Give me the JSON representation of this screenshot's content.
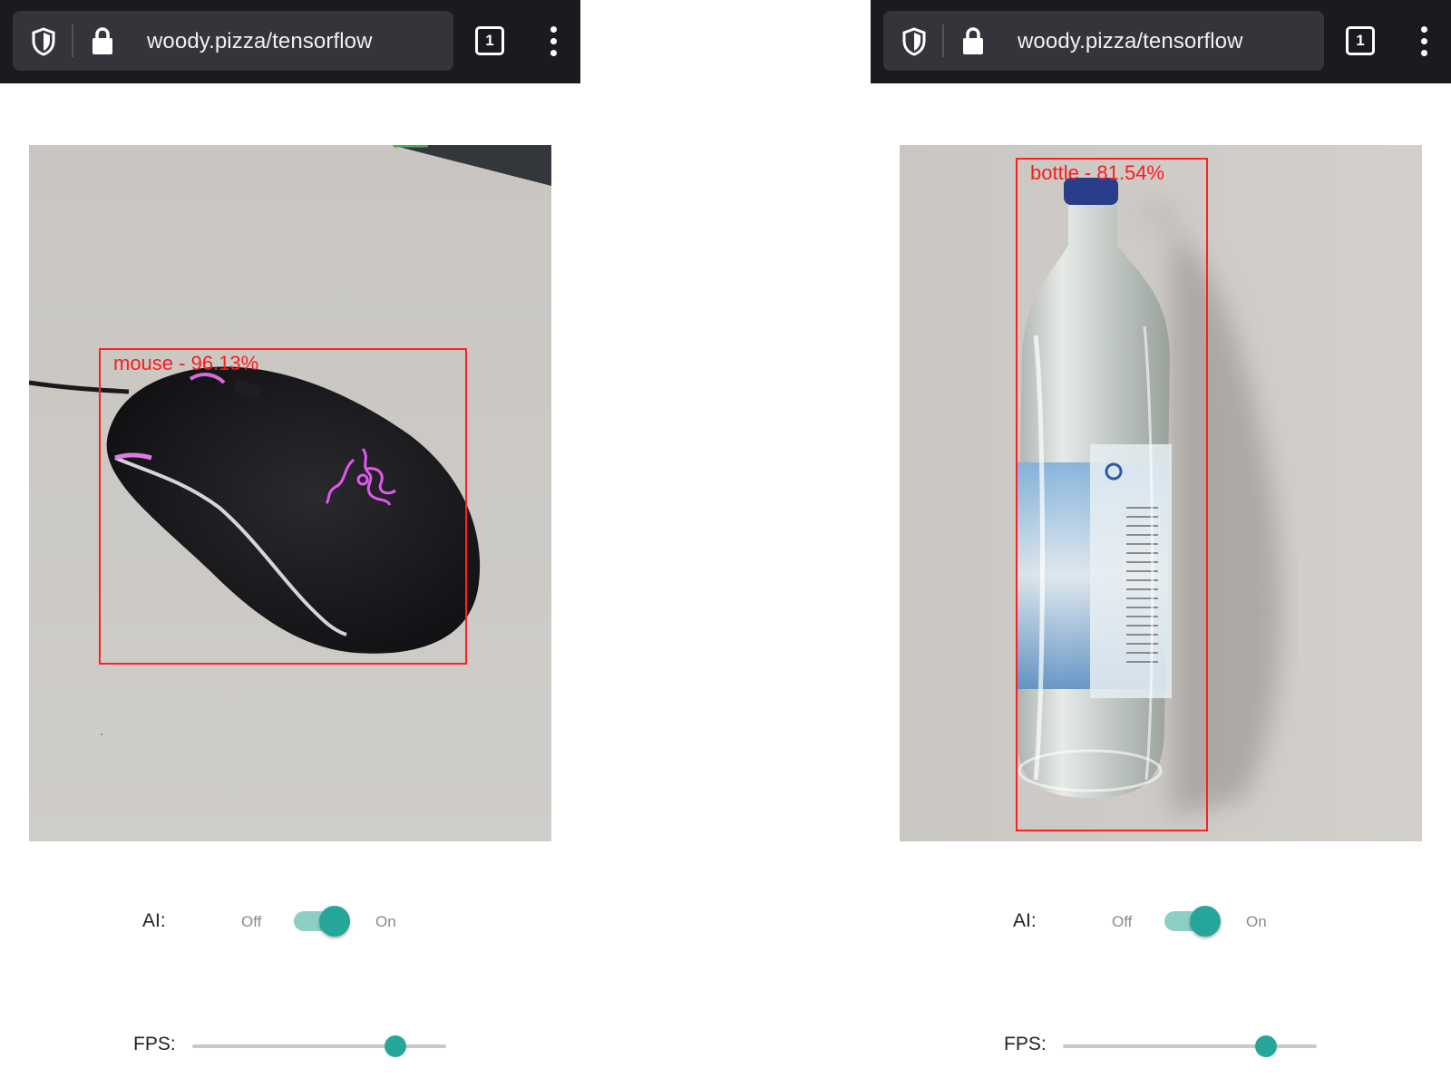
{
  "screens": [
    {
      "browser": {
        "url": "woody.pizza/tensorflow",
        "tab_count": "1",
        "icons": [
          "shield-icon",
          "lock-icon",
          "tabs-icon",
          "more-vert-icon"
        ]
      },
      "detection": {
        "label": "mouse - 96.13%"
      },
      "controls": {
        "ai_label": "AI:",
        "off_label": "Off",
        "on_label": "On",
        "ai_enabled": true,
        "fps_label": "FPS:",
        "fps_value_fraction": 0.8
      }
    },
    {
      "browser": {
        "url": "woody.pizza/tensorflow",
        "tab_count": "1",
        "icons": [
          "shield-icon",
          "lock-icon",
          "tabs-icon",
          "more-vert-icon"
        ]
      },
      "detection": {
        "label": "bottle - 81.54%"
      },
      "controls": {
        "ai_label": "AI:",
        "off_label": "Off",
        "on_label": "On",
        "ai_enabled": true,
        "fps_label": "FPS:",
        "fps_value_fraction": 0.8
      }
    }
  ],
  "colors": {
    "toolbar_bg": "#1b1a1f",
    "urlbar_bg": "#35343a",
    "accent": "#26a69a",
    "accent_light": "#8dcfc4",
    "bbox": "#ff2020"
  }
}
